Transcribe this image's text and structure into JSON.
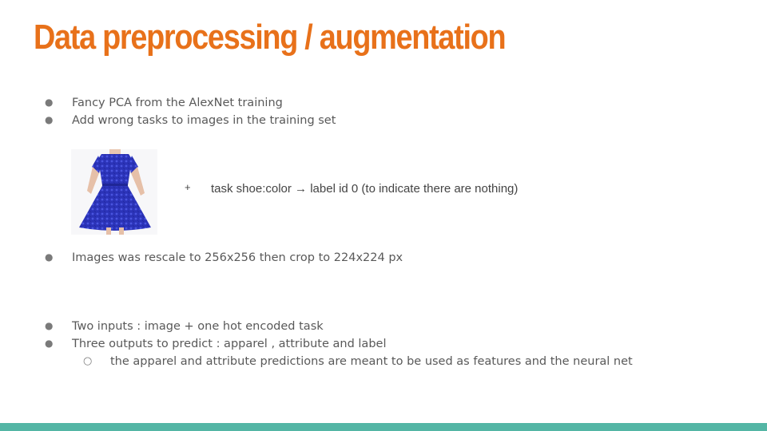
{
  "slide": {
    "title": "Data preprocessing / augmentation",
    "bullets_top": [
      {
        "text": "Fancy PCA from the AlexNet training"
      },
      {
        "text": "Add wrong tasks to images in the training set"
      }
    ],
    "image_row": {
      "image": "blue-lace-dress-photo",
      "plus": "+",
      "task": "task shoe:color → label id 0 (to indicate there are nothing)"
    },
    "bullet_mid": {
      "text": "Images was rescale to 256x256 then crop to 224x224 px"
    },
    "bullets_bottom": [
      {
        "text": "Two inputs : image + one hot encoded task"
      },
      {
        "text": "Three outputs to predict : apparel , attribute and label"
      }
    ],
    "sub_bullet": {
      "text": "the apparel and attribute predictions are meant to be used as features and the neural net"
    },
    "bullet_glyph": "●",
    "sub_bullet_glyph": "○",
    "colors": {
      "title": "#e8711a",
      "text": "#595959",
      "footer": "#54b6a5",
      "dress": "#2b33b8"
    }
  }
}
